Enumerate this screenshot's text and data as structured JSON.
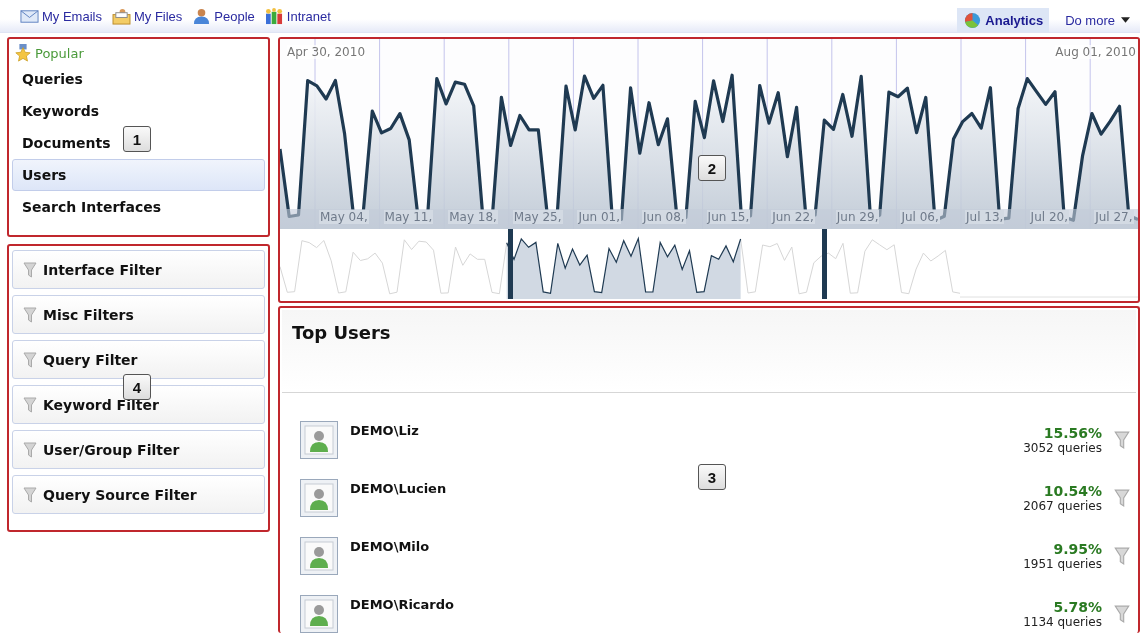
{
  "nav": {
    "links": [
      {
        "label": "My Emails",
        "kind": "mail"
      },
      {
        "label": "My Files",
        "kind": "files"
      },
      {
        "label": "People",
        "kind": "people"
      },
      {
        "label": "Intranet",
        "kind": "intranet"
      }
    ],
    "right": [
      {
        "label": "Analytics",
        "kind": "analytics",
        "selected": true
      },
      {
        "label": "Do more",
        "kind": "menu",
        "selected": false
      }
    ]
  },
  "sidebar": {
    "section": "Popular",
    "items": [
      {
        "label": "Queries",
        "selected": false
      },
      {
        "label": "Keywords",
        "selected": false
      },
      {
        "label": "Documents",
        "selected": false
      },
      {
        "label": "Users",
        "selected": true
      },
      {
        "label": "Search Interfaces",
        "selected": false
      }
    ]
  },
  "filters": [
    "Interface Filter",
    "Misc Filters",
    "Query Filter",
    "Keyword Filter",
    "User/Group Filter",
    "Query Source Filter"
  ],
  "chart": {
    "start_label": "Apr 30, 2010",
    "end_label": "Aug 01, 2010",
    "week_labels": [
      "May 04,",
      "May 11,",
      "May 18,",
      "May 25,",
      "Jun 01,",
      "Jun 08,",
      "Jun 15,",
      "Jun 22,",
      "Jun 29,",
      "Jul 06,",
      "Jul 13,",
      "Jul 20,",
      "Jul 27,"
    ]
  },
  "top_users": {
    "title": "Top Users",
    "rows": [
      {
        "name": "DEMO\\Liz",
        "percent": "15.56%",
        "count": "3052 queries"
      },
      {
        "name": "DEMO\\Lucien",
        "percent": "10.54%",
        "count": "2067 queries"
      },
      {
        "name": "DEMO\\Milo",
        "percent": "9.95%",
        "count": "1951 queries"
      },
      {
        "name": "DEMO\\Ricardo",
        "percent": "5.78%",
        "count": "1134 queries"
      }
    ]
  },
  "callouts": [
    "1",
    "2",
    "3",
    "4"
  ]
}
